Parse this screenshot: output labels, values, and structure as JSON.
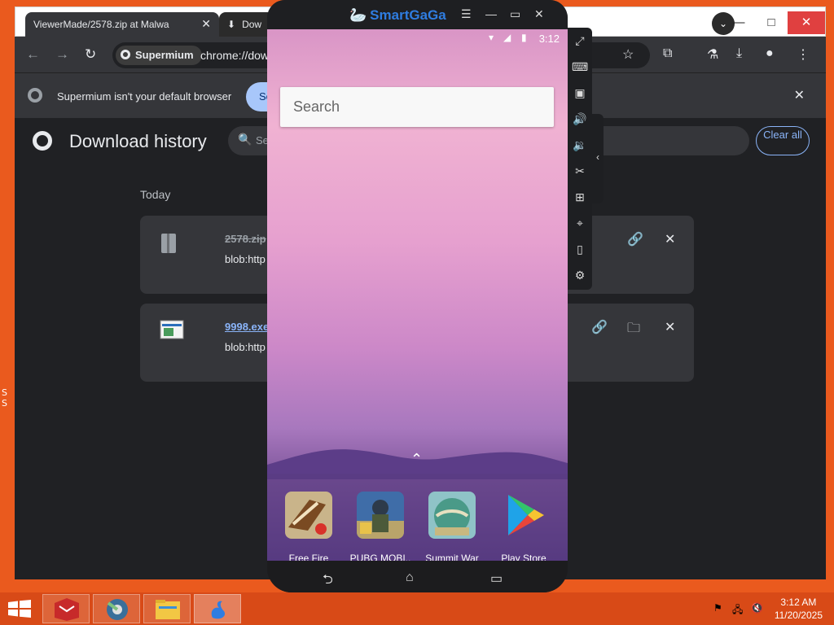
{
  "desktop": {
    "left_text": "S\nS"
  },
  "browser": {
    "tabs": [
      {
        "label": "ViewerMade/2578.zip at Malwa"
      },
      {
        "label": "Dow"
      }
    ],
    "omnibox": {
      "chip": "Supermium",
      "url": "chrome://dow"
    },
    "infobar": {
      "message": "Supermium isn't your default browser",
      "button": "Se"
    },
    "downloads": {
      "title": "Download history",
      "search_placeholder": "Se",
      "clear_all": "Clear all",
      "section": "Today",
      "items": [
        {
          "name": "2578.zip",
          "url": "blob:http",
          "status": "removed"
        },
        {
          "name": "9998.exe",
          "url": "blob:http",
          "status": "complete"
        }
      ]
    }
  },
  "emulator": {
    "brand": "SmartGaGa",
    "status_time": "3:12",
    "search_placeholder": "Search",
    "dock_apps": [
      {
        "label": "Free Fire",
        "icon": "free-fire-icon"
      },
      {
        "label": "PUBG MOBI..",
        "icon": "pubg-icon"
      },
      {
        "label": "Summit War",
        "icon": "summit-war-icon"
      },
      {
        "label": "Play Store",
        "icon": "play-store-icon"
      }
    ]
  },
  "taskbar": {
    "time": "3:12 AM",
    "date": "11/20/2025"
  },
  "colors": {
    "desktop_bg": "#ea5a1e",
    "taskbar_bg": "#d84a17",
    "chrome_dark": "#202124",
    "link_blue": "#8ab4f8",
    "emulator_brand": "#2f7de1"
  }
}
